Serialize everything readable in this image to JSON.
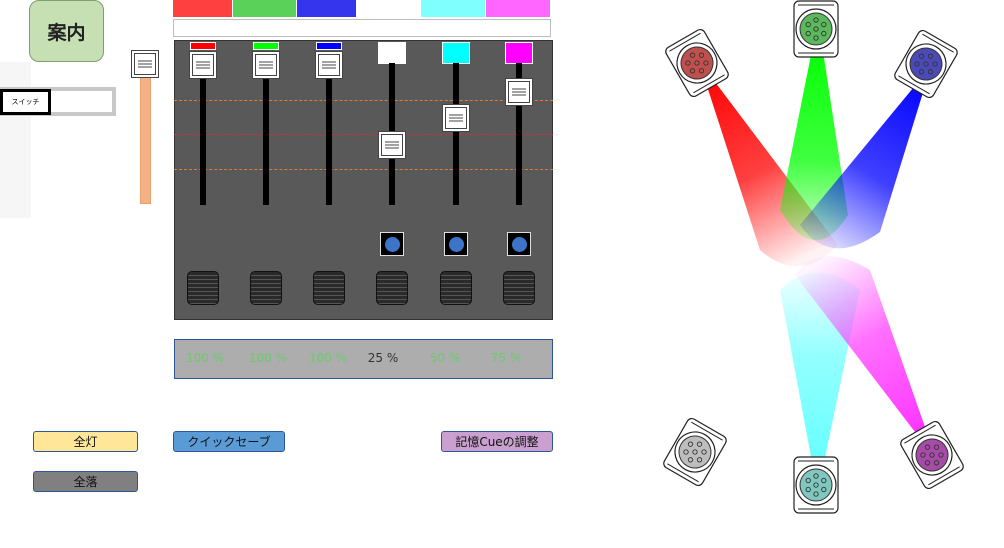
{
  "guide_button": {
    "label": "案内"
  },
  "switch": {
    "label": "スイッチ"
  },
  "master_fader": {
    "level": 1.0
  },
  "top_strip": {
    "colors": [
      "#ff4040",
      "#5ad25a",
      "#3535ee",
      "#ffffff",
      "#80ffff",
      "#ff66ff"
    ]
  },
  "channels": [
    {
      "color": "#ff0000",
      "fader_level": 1.0,
      "has_button": false
    },
    {
      "color": "#00ff00",
      "fader_level": 1.0,
      "has_button": false
    },
    {
      "color": "#0000ff",
      "fader_level": 1.0,
      "has_button": false
    },
    {
      "color": "#ffffff",
      "fader_level": 0.25,
      "has_button": true
    },
    {
      "color": "#00ffff",
      "fader_level": 0.5,
      "has_button": true
    },
    {
      "color": "#ff00ff",
      "fader_level": 0.75,
      "has_button": true
    }
  ],
  "levels": {
    "ch1": "100 %",
    "ch2": "100 %",
    "ch3": "100 %",
    "ch4": "25 %",
    "ch5": "50 %",
    "ch6": "75 %",
    "colors": [
      "#6bcb6b",
      "#6bcb6b",
      "#6bcb6b",
      "#333333",
      "#6bcb6b",
      "#6bcb6b"
    ]
  },
  "buttons": {
    "all_on": "全灯",
    "quick_save": "クイックセーブ",
    "cue_adjust": "記憶Cueの調整",
    "blackout": "全落"
  },
  "fixtures": [
    {
      "name": "red",
      "color": "#c0504d"
    },
    {
      "name": "green",
      "color": "#5cb85c"
    },
    {
      "name": "blue",
      "color": "#4b4bb8"
    },
    {
      "name": "white",
      "color": "#bdbdbd"
    },
    {
      "name": "cyan",
      "color": "#7fc7bf"
    },
    {
      "name": "magenta",
      "color": "#a64ca6"
    }
  ]
}
